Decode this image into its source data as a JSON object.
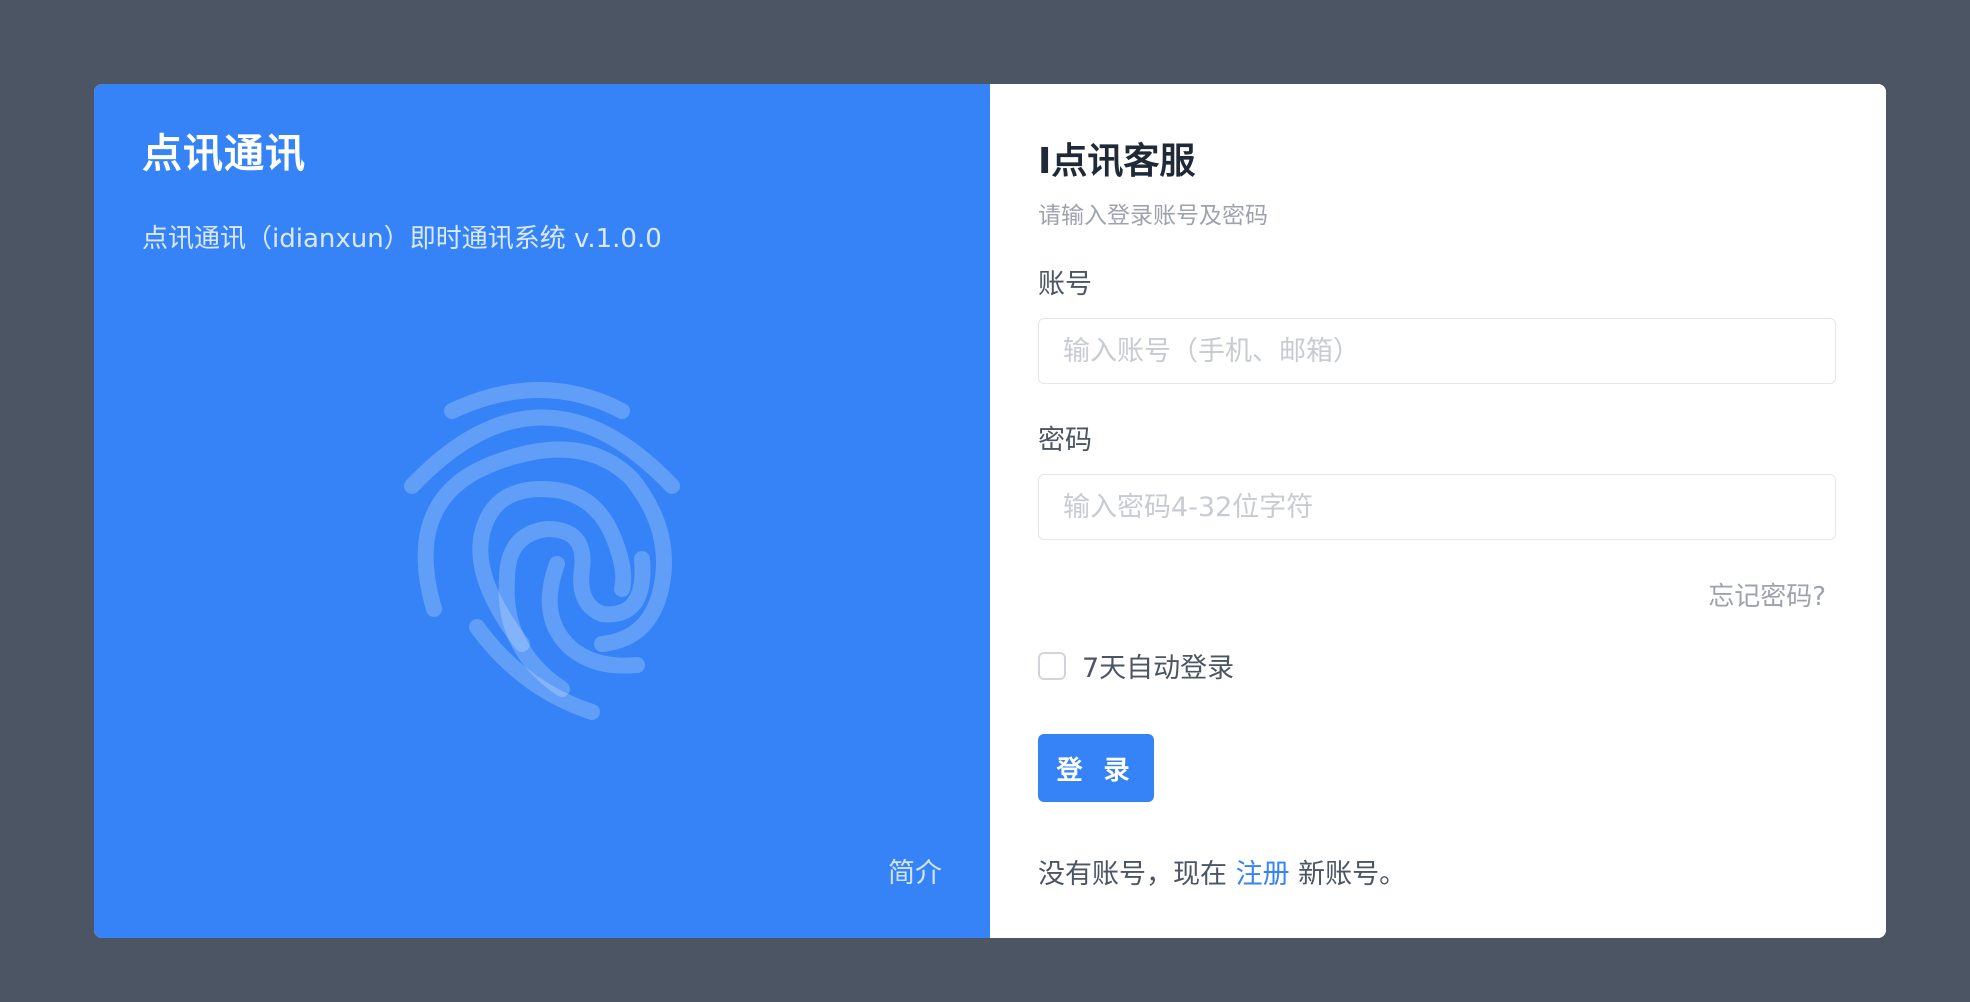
{
  "brand": {
    "title": "点讯通讯",
    "subtitle": "点讯通讯（idianxun）即时通讯系统 v.1.0.0",
    "intro_link": "简介",
    "icon": "fingerprint-icon"
  },
  "form": {
    "title": "I点讯客服",
    "hint": "请输入登录账号及密码",
    "account": {
      "label": "账号",
      "placeholder": "输入账号（手机、邮箱）",
      "value": ""
    },
    "password": {
      "label": "密码",
      "placeholder": "输入密码4-32位字符",
      "value": ""
    },
    "forgot_label": "忘记密码?",
    "remember": {
      "label": "7天自动登录",
      "checked": false
    },
    "login_label": "登 录",
    "register": {
      "prefix": "没有账号，现在 ",
      "link": "注册",
      "suffix": " 新账号。"
    }
  },
  "colors": {
    "brand_blue": "#3583f7",
    "backdrop": "#4b5563"
  }
}
